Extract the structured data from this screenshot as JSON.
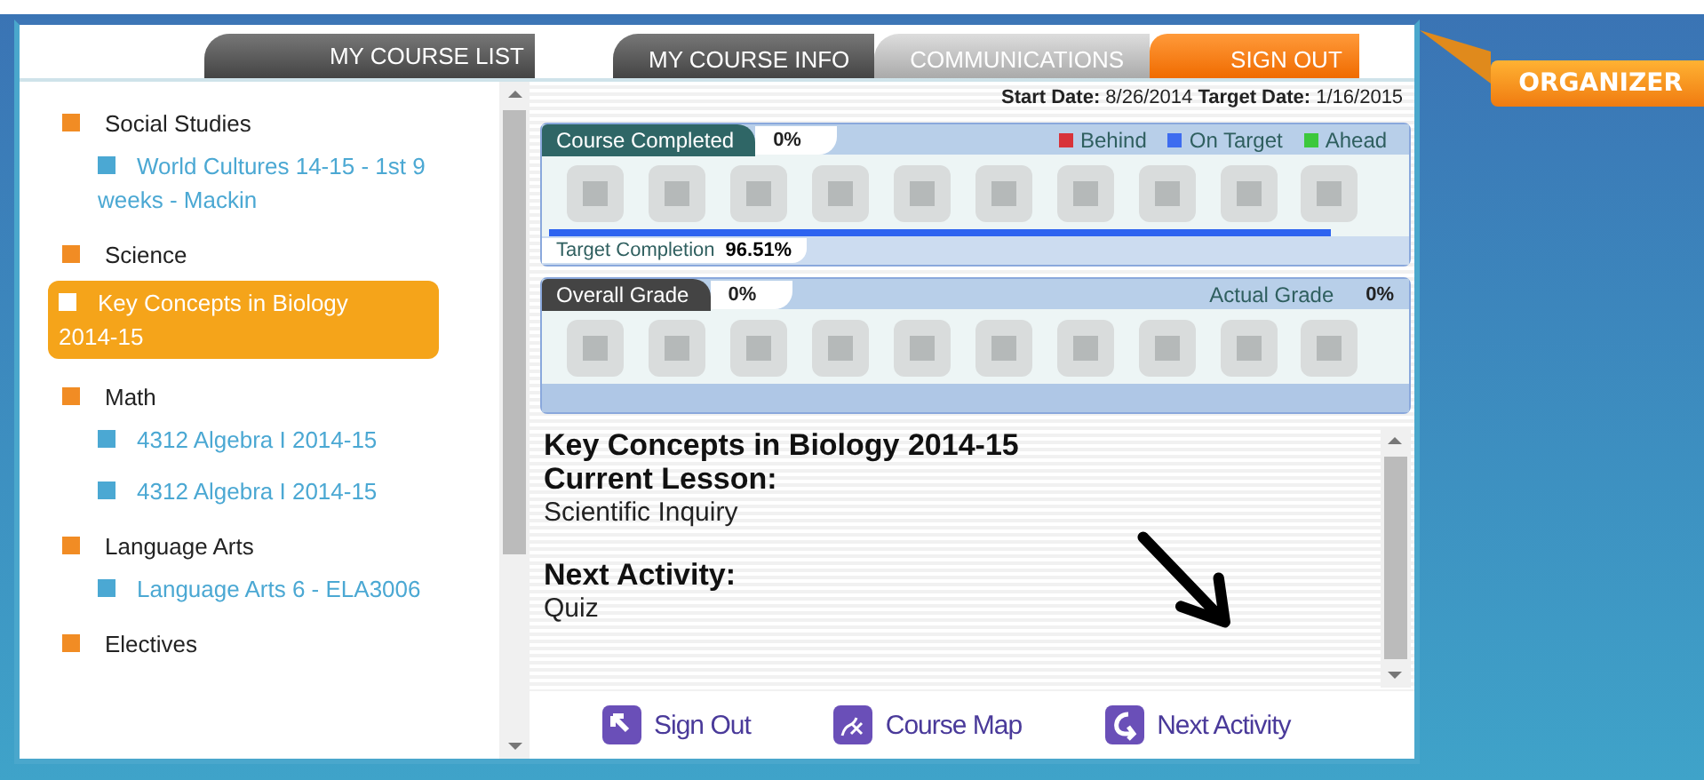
{
  "left_panel": {
    "title": "MY COURSE LIST"
  },
  "tabs": [
    {
      "label": "MY COURSE INFO",
      "selected": true
    },
    {
      "label": "COMMUNICATIONS",
      "selected": false
    }
  ],
  "sign_out_tab": "SIGN OUT",
  "organizer": "ORGANIZER",
  "categories": [
    {
      "name": "Social Studies",
      "courses": [
        {
          "title": "World Cultures 14-15 - 1st 9 weeks - Mackin",
          "selected": false
        }
      ]
    },
    {
      "name": "Science",
      "courses": [
        {
          "title": "Key Concepts in Biology 2014-15",
          "selected": true
        }
      ]
    },
    {
      "name": "Math",
      "courses": [
        {
          "title": "4312 Algebra I 2014-15",
          "selected": false
        },
        {
          "title": "4312 Algebra I 2014-15",
          "selected": false
        }
      ]
    },
    {
      "name": "Language Arts",
      "courses": [
        {
          "title": "Language Arts 6 - ELA3006",
          "selected": false
        }
      ]
    },
    {
      "name": "Electives"
    }
  ],
  "dates": {
    "start_label": "Start Date:",
    "start": "8/26/2014",
    "target_label": "Target Date:",
    "target": "1/16/2015"
  },
  "completion": {
    "title": "Course Completed",
    "value": "0%",
    "legend": [
      {
        "label": "Behind",
        "color": "#d8333a"
      },
      {
        "label": "On Target",
        "color": "#3d6cf0"
      },
      {
        "label": "Ahead",
        "color": "#3cc83c"
      }
    ],
    "target_label": "Target Completion",
    "target_value": "96.51%",
    "level": 0.9651
  },
  "grade": {
    "title": "Overall Grade",
    "value": "0%",
    "actual_label": "Actual Grade",
    "actual_value": "0%"
  },
  "lesson": {
    "course": "Key Concepts in Biology 2014-15",
    "current_label": "Current Lesson:",
    "current": "Scientific Inquiry",
    "next_label": "Next Activity:",
    "next": "Quiz"
  },
  "actions": [
    {
      "label": "Sign Out",
      "kind": "signout"
    },
    {
      "label": "Course Map",
      "kind": "map"
    },
    {
      "label": "Next Activity",
      "kind": "next"
    }
  ]
}
